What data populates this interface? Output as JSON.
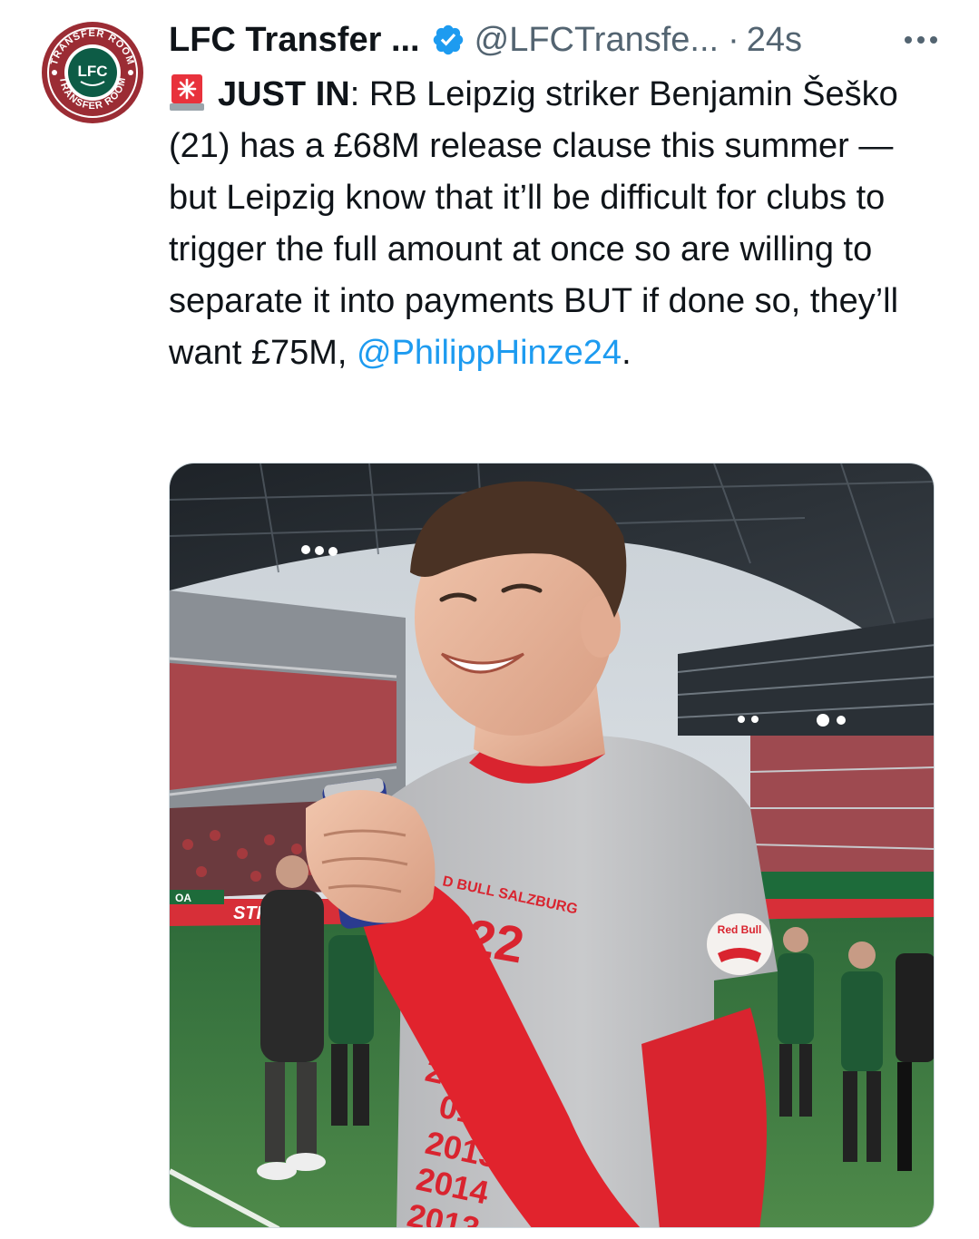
{
  "tweet": {
    "author_name": "LFC Transfer ...",
    "handle": "@LFCTransfe...",
    "separator": "·",
    "time": "24s",
    "verified": true,
    "avatar": {
      "ring_top_text": "TRANSFER ROOM",
      "ring_bottom_text": "TRANSFER ROOM",
      "crest_text": "LFC"
    },
    "emoji": "rotating-light-emoji",
    "lead": "JUST IN",
    "lead_suffix": ":",
    "text": " RB Leipzig striker Benjamin Šeško (21) has a £68M release clause this summer — but Leipzig know that it’ll be difficult for clubs to trigger the full amount at once so are willing to separate it into payments BUT if done so, they’ll want £75M, ",
    "mention": "@PhilippHinze24",
    "text_end": ".",
    "more_icon": "more-options-icon"
  },
  "media": {
    "description_icon": "photo",
    "shirt_text": "D BULL SALZBURG",
    "shirt_big": "22",
    "shirt_years": [
      "20",
      "016",
      "2015",
      "2014",
      "2013"
    ],
    "badge_text": "Red Bull",
    "sign_text": "STR",
    "board_text": "OA"
  },
  "colors": {
    "link": "#1d9bf0",
    "muted": "#536471",
    "verified": "#1d9bf0",
    "avatar_bg": "#9b2c34",
    "avatar_ring": "#0d5c46"
  }
}
